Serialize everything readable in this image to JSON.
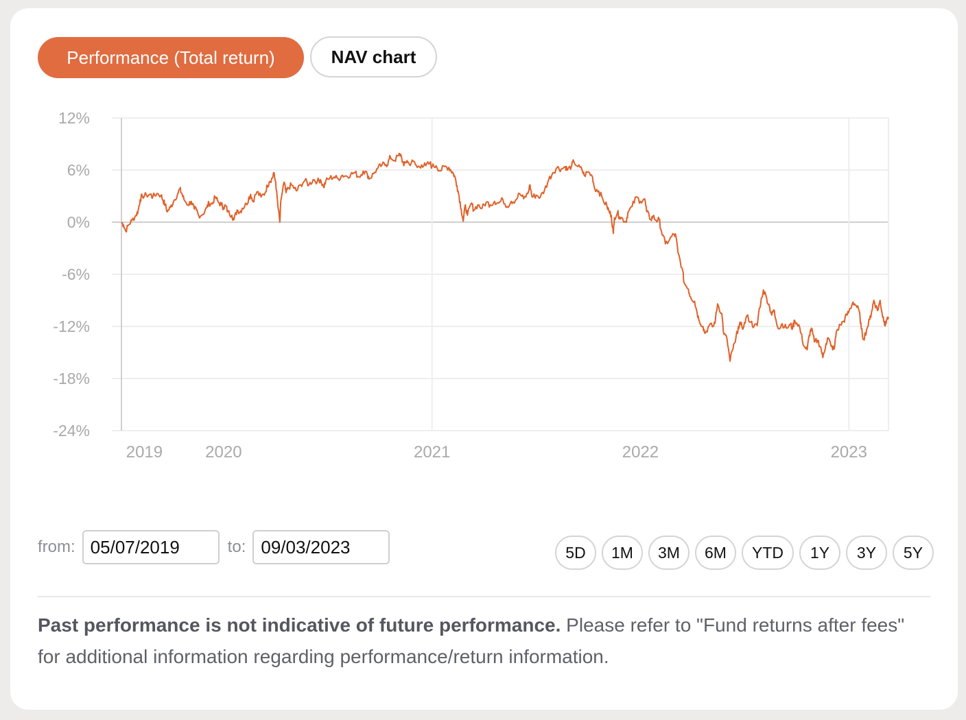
{
  "tabs": {
    "performance_label": "Performance (Total return)",
    "nav_label": "NAV chart",
    "active": "performance"
  },
  "range": {
    "from_label": "from:",
    "from_value": "05/07/2019",
    "to_label": "to:",
    "to_value": "09/03/2023"
  },
  "periods": [
    "5D",
    "1M",
    "3M",
    "6M",
    "YTD",
    "1Y",
    "3Y",
    "5Y"
  ],
  "disclaimer": {
    "bold": "Past performance is not indicative of future performance.",
    "text": " Please refer to \"Fund returns after fees\" for additional information regarding performance/return information."
  },
  "colors": {
    "accent": "#e06c40",
    "line": "#e0612a",
    "grid": "#eeeeee",
    "zero_line": "#cfcfcf",
    "axis_text": "#a9a9a9"
  },
  "chart_data": {
    "type": "line",
    "title": "",
    "xlabel": "",
    "ylabel": "",
    "ylim": [
      -24,
      12
    ],
    "yticks": [
      12,
      6,
      0,
      -6,
      -12,
      -18,
      -24
    ],
    "ytick_labels": [
      "12%",
      "6%",
      "0%",
      "-6%",
      "-12%",
      "-18%",
      "-24%"
    ],
    "xlim": [
      2019.51,
      2023.19
    ],
    "xticks": [
      {
        "x": 2019.62,
        "label": "2019"
      },
      {
        "x": 2020.0,
        "label": "2020"
      },
      {
        "x": 2021.0,
        "label": "2021"
      },
      {
        "x": 2022.0,
        "label": "2022"
      },
      {
        "x": 2023.0,
        "label": "2023"
      }
    ],
    "grid": true,
    "series": [
      {
        "name": "Total return",
        "points": [
          [
            2019.51,
            0.0
          ],
          [
            2019.52,
            -0.3
          ],
          [
            2019.53,
            -1.0
          ],
          [
            2019.545,
            -0.3
          ],
          [
            2019.56,
            0.2
          ],
          [
            2019.58,
            0.8
          ],
          [
            2019.59,
            1.3
          ],
          [
            2019.6,
            2.6
          ],
          [
            2019.61,
            3.0
          ],
          [
            2019.63,
            3.1
          ],
          [
            2019.65,
            3.2
          ],
          [
            2019.66,
            2.9
          ],
          [
            2019.68,
            3.3
          ],
          [
            2019.7,
            3.1
          ],
          [
            2019.71,
            2.5
          ],
          [
            2019.72,
            2.0
          ],
          [
            2019.73,
            1.2
          ],
          [
            2019.745,
            1.7
          ],
          [
            2019.76,
            2.4
          ],
          [
            2019.78,
            3.3
          ],
          [
            2019.79,
            3.8
          ],
          [
            2019.8,
            3.3
          ],
          [
            2019.81,
            2.6
          ],
          [
            2019.83,
            2.0
          ],
          [
            2019.845,
            2.4
          ],
          [
            2019.86,
            1.5
          ],
          [
            2019.87,
            1.4
          ],
          [
            2019.88,
            0.8
          ],
          [
            2019.9,
            0.9
          ],
          [
            2019.92,
            1.7
          ],
          [
            2019.93,
            2.2
          ],
          [
            2019.945,
            2.1
          ],
          [
            2019.96,
            2.9
          ],
          [
            2019.975,
            2.3
          ],
          [
            2019.99,
            2.0
          ],
          [
            2020.0,
            1.7
          ],
          [
            2020.01,
            1.9
          ],
          [
            2020.02,
            1.2
          ],
          [
            2020.04,
            0.8
          ],
          [
            2020.05,
            0.3
          ],
          [
            2020.065,
            1.4
          ],
          [
            2020.08,
            1.2
          ],
          [
            2020.09,
            1.6
          ],
          [
            2020.11,
            2.1
          ],
          [
            2020.12,
            2.7
          ],
          [
            2020.13,
            3.2
          ],
          [
            2020.14,
            2.4
          ],
          [
            2020.16,
            3.5
          ],
          [
            2020.18,
            2.9
          ],
          [
            2020.2,
            3.4
          ],
          [
            2020.21,
            4.2
          ],
          [
            2020.22,
            4.7
          ],
          [
            2020.235,
            5.1
          ],
          [
            2020.24,
            5.7
          ],
          [
            2020.25,
            4.6
          ],
          [
            2020.26,
            2.0
          ],
          [
            2020.27,
            0.0
          ],
          [
            2020.275,
            2.5
          ],
          [
            2020.29,
            4.6
          ],
          [
            2020.3,
            3.4
          ],
          [
            2020.31,
            3.9
          ],
          [
            2020.325,
            4.3
          ],
          [
            2020.34,
            3.9
          ],
          [
            2020.35,
            3.6
          ],
          [
            2020.37,
            4.3
          ],
          [
            2020.39,
            4.8
          ],
          [
            2020.41,
            4.3
          ],
          [
            2020.43,
            4.9
          ],
          [
            2020.45,
            4.7
          ],
          [
            2020.465,
            4.9
          ],
          [
            2020.48,
            4.0
          ],
          [
            2020.49,
            4.7
          ],
          [
            2020.51,
            5.1
          ],
          [
            2020.53,
            5.2
          ],
          [
            2020.55,
            5.0
          ],
          [
            2020.57,
            5.4
          ],
          [
            2020.59,
            5.3
          ],
          [
            2020.61,
            5.5
          ],
          [
            2020.63,
            5.7
          ],
          [
            2020.65,
            5.2
          ],
          [
            2020.67,
            5.9
          ],
          [
            2020.69,
            5.5
          ],
          [
            2020.7,
            5.0
          ],
          [
            2020.72,
            5.6
          ],
          [
            2020.74,
            6.2
          ],
          [
            2020.76,
            6.6
          ],
          [
            2020.78,
            6.6
          ],
          [
            2020.79,
            6.9
          ],
          [
            2020.8,
            7.5
          ],
          [
            2020.82,
            7.1
          ],
          [
            2020.84,
            7.7
          ],
          [
            2020.85,
            7.8
          ],
          [
            2020.865,
            6.5
          ],
          [
            2020.88,
            7.1
          ],
          [
            2020.89,
            6.7
          ],
          [
            2020.91,
            7.0
          ],
          [
            2020.93,
            6.3
          ],
          [
            2020.95,
            6.6
          ],
          [
            2020.97,
            6.5
          ],
          [
            2020.99,
            6.8
          ],
          [
            2021.0,
            6.4
          ],
          [
            2021.02,
            6.5
          ],
          [
            2021.04,
            5.9
          ],
          [
            2021.06,
            6.4
          ],
          [
            2021.08,
            6.3
          ],
          [
            2021.09,
            6.0
          ],
          [
            2021.1,
            5.7
          ],
          [
            2021.11,
            5.2
          ],
          [
            2021.12,
            4.2
          ],
          [
            2021.13,
            3.0
          ],
          [
            2021.14,
            1.5
          ],
          [
            2021.15,
            0.1
          ],
          [
            2021.16,
            2.0
          ],
          [
            2021.17,
            0.8
          ],
          [
            2021.19,
            2.2
          ],
          [
            2021.2,
            1.4
          ],
          [
            2021.22,
            2.0
          ],
          [
            2021.24,
            1.6
          ],
          [
            2021.26,
            2.3
          ],
          [
            2021.28,
            2.0
          ],
          [
            2021.3,
            2.4
          ],
          [
            2021.32,
            2.2
          ],
          [
            2021.34,
            2.6
          ],
          [
            2021.36,
            1.8
          ],
          [
            2021.38,
            2.4
          ],
          [
            2021.4,
            2.5
          ],
          [
            2021.42,
            3.3
          ],
          [
            2021.44,
            2.7
          ],
          [
            2021.46,
            3.3
          ],
          [
            2021.47,
            4.3
          ],
          [
            2021.48,
            2.9
          ],
          [
            2021.5,
            3.1
          ],
          [
            2021.52,
            2.9
          ],
          [
            2021.54,
            3.7
          ],
          [
            2021.56,
            4.9
          ],
          [
            2021.58,
            5.7
          ],
          [
            2021.6,
            6.3
          ],
          [
            2021.62,
            6.1
          ],
          [
            2021.64,
            6.4
          ],
          [
            2021.65,
            6.0
          ],
          [
            2021.67,
            6.5
          ],
          [
            2021.68,
            7.0
          ],
          [
            2021.7,
            6.4
          ],
          [
            2021.72,
            6.0
          ],
          [
            2021.73,
            5.4
          ],
          [
            2021.75,
            5.8
          ],
          [
            2021.77,
            5.2
          ],
          [
            2021.78,
            3.9
          ],
          [
            2021.8,
            3.6
          ],
          [
            2021.82,
            2.6
          ],
          [
            2021.84,
            1.8
          ],
          [
            2021.85,
            1.2
          ],
          [
            2021.86,
            0.8
          ],
          [
            2021.87,
            -1.3
          ],
          [
            2021.875,
            0.5
          ],
          [
            2021.89,
            1.1
          ],
          [
            2021.9,
            0.6
          ],
          [
            2021.915,
            0.4
          ],
          [
            2021.93,
            0.0
          ],
          [
            2021.94,
            1.1
          ],
          [
            2021.96,
            1.8
          ],
          [
            2021.98,
            2.9
          ],
          [
            2022.0,
            2.4
          ],
          [
            2022.02,
            2.7
          ],
          [
            2022.03,
            1.2
          ],
          [
            2022.05,
            0.3
          ],
          [
            2022.06,
            0.7
          ],
          [
            2022.075,
            0.2
          ],
          [
            2022.09,
            0.3
          ],
          [
            2022.1,
            -1.0
          ],
          [
            2022.12,
            -2.5
          ],
          [
            2022.14,
            -2.0
          ],
          [
            2022.16,
            -1.4
          ],
          [
            2022.17,
            -1.6
          ],
          [
            2022.18,
            -3.5
          ],
          [
            2022.2,
            -5.3
          ],
          [
            2022.21,
            -7.0
          ],
          [
            2022.23,
            -7.7
          ],
          [
            2022.24,
            -8.6
          ],
          [
            2022.26,
            -9.1
          ],
          [
            2022.27,
            -10.2
          ],
          [
            2022.28,
            -11.2
          ],
          [
            2022.3,
            -12.0
          ],
          [
            2022.31,
            -12.8
          ],
          [
            2022.33,
            -11.9
          ],
          [
            2022.35,
            -12.0
          ],
          [
            2022.36,
            -11.2
          ],
          [
            2022.37,
            -9.4
          ],
          [
            2022.39,
            -10.5
          ],
          [
            2022.4,
            -12.9
          ],
          [
            2022.415,
            -13.4
          ],
          [
            2022.43,
            -16.0
          ],
          [
            2022.44,
            -14.8
          ],
          [
            2022.455,
            -13.8
          ],
          [
            2022.47,
            -12.0
          ],
          [
            2022.48,
            -11.8
          ],
          [
            2022.495,
            -12.1
          ],
          [
            2022.51,
            -10.8
          ],
          [
            2022.53,
            -11.5
          ],
          [
            2022.545,
            -12.0
          ],
          [
            2022.56,
            -11.9
          ],
          [
            2022.57,
            -10.0
          ],
          [
            2022.59,
            -7.8
          ],
          [
            2022.605,
            -8.7
          ],
          [
            2022.62,
            -9.8
          ],
          [
            2022.63,
            -10.7
          ],
          [
            2022.64,
            -10.1
          ],
          [
            2022.65,
            -11.2
          ],
          [
            2022.665,
            -12.3
          ],
          [
            2022.68,
            -11.7
          ],
          [
            2022.7,
            -12.2
          ],
          [
            2022.72,
            -11.8
          ],
          [
            2022.73,
            -12.2
          ],
          [
            2022.74,
            -11.3
          ],
          [
            2022.76,
            -11.8
          ],
          [
            2022.77,
            -12.8
          ],
          [
            2022.785,
            -14.3
          ],
          [
            2022.8,
            -14.7
          ],
          [
            2022.81,
            -13.0
          ],
          [
            2022.82,
            -12.2
          ],
          [
            2022.835,
            -13.8
          ],
          [
            2022.85,
            -13.6
          ],
          [
            2022.865,
            -14.4
          ],
          [
            2022.875,
            -15.6
          ],
          [
            2022.89,
            -14.0
          ],
          [
            2022.9,
            -13.3
          ],
          [
            2022.915,
            -14.3
          ],
          [
            2022.93,
            -14.6
          ],
          [
            2022.94,
            -12.6
          ],
          [
            2022.96,
            -11.8
          ],
          [
            2022.975,
            -11.4
          ],
          [
            2022.99,
            -10.7
          ],
          [
            2023.0,
            -10.3
          ],
          [
            2023.02,
            -9.2
          ],
          [
            2023.035,
            -9.6
          ],
          [
            2023.05,
            -10.3
          ],
          [
            2023.06,
            -12.3
          ],
          [
            2023.07,
            -13.5
          ],
          [
            2023.085,
            -12.4
          ],
          [
            2023.1,
            -11.2
          ],
          [
            2023.11,
            -10.2
          ],
          [
            2023.12,
            -9.0
          ],
          [
            2023.13,
            -9.7
          ],
          [
            2023.14,
            -10.1
          ],
          [
            2023.15,
            -9.0
          ],
          [
            2023.16,
            -10.6
          ],
          [
            2023.17,
            -11.4
          ],
          [
            2023.175,
            -11.9
          ],
          [
            2023.18,
            -11.3
          ],
          [
            2023.19,
            -10.9
          ]
        ]
      }
    ]
  }
}
